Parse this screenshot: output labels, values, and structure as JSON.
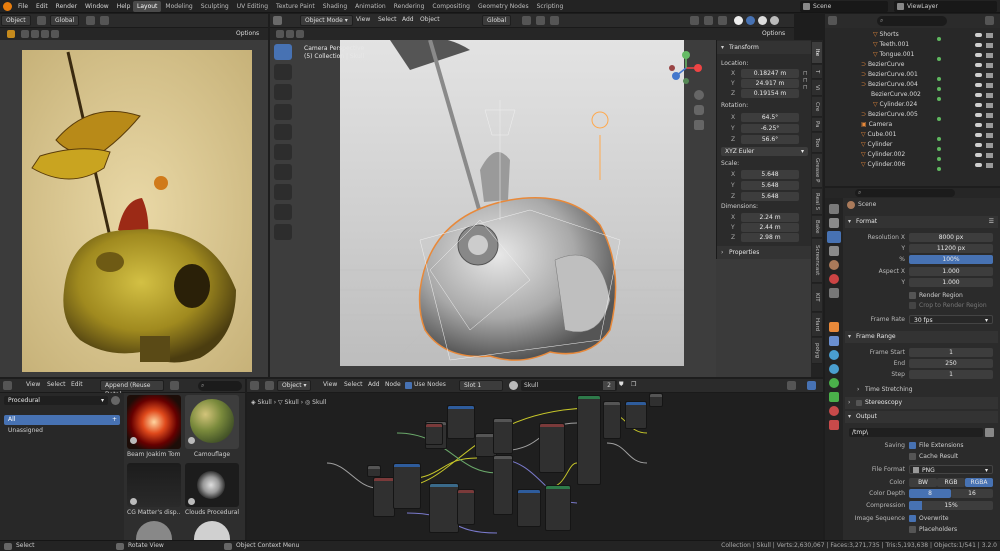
{
  "topbar": {
    "menus": [
      "File",
      "Edit",
      "Render",
      "Window",
      "Help"
    ],
    "workspaces": [
      "Layout",
      "Modeling",
      "Sculpting",
      "UV Editing",
      "Texture Paint",
      "Shading",
      "Animation",
      "Rendering",
      "Compositing",
      "Geometry Nodes",
      "Scripting"
    ],
    "active_workspace": "Layout",
    "scene": "Scene",
    "view_layer": "ViewLayer"
  },
  "image_editor": {
    "mode": "Object",
    "orientation": "Global",
    "options": "Options"
  },
  "viewport": {
    "mode": "Object Mode",
    "menus": [
      "View",
      "Select",
      "Add",
      "Object"
    ],
    "orientation": "Global",
    "options": "Options",
    "camera_label": "Camera Perspective",
    "collection_label": "(5) Collection | Skull"
  },
  "n_panel": {
    "transform_title": "Transform",
    "location_label": "Location:",
    "location": [
      [
        "X",
        "0.18247 m"
      ],
      [
        "Y",
        "24.917 m"
      ],
      [
        "Z",
        "0.19154 m"
      ]
    ],
    "rotation_label": "Rotation:",
    "rotation": [
      [
        "X",
        "64.5°"
      ],
      [
        "Y",
        "-6.25°"
      ],
      [
        "Z",
        "56.6°"
      ]
    ],
    "euler": "XYZ Euler",
    "scale_label": "Scale:",
    "scale": [
      [
        "X",
        "5.648"
      ],
      [
        "Y",
        "5.648"
      ],
      [
        "Z",
        "5.648"
      ]
    ],
    "dimensions_label": "Dimensions:",
    "dimensions": [
      [
        "X",
        "2.24 m"
      ],
      [
        "Y",
        "2.44 m"
      ],
      [
        "Z",
        "2.98 m"
      ]
    ],
    "properties": "Properties",
    "tabs": [
      "Ite",
      "T",
      "Vi",
      "Cre",
      "Pa",
      "Too",
      "Grease P",
      "Real S",
      "Bake",
      "Screencast",
      "KIT",
      "Hard",
      "polyg"
    ]
  },
  "outliner": {
    "items": [
      "Shorts",
      "Teeth.001",
      "Tongue.001",
      "BezierCurve",
      "BezierCurve.001",
      "BezierCurve.004",
      "BezierCurve.002",
      "Cylinder.024",
      "BezierCurve.005",
      "Camera",
      "Cube.001",
      "Cylinder",
      "Cylinder.002",
      "Cylinder.006"
    ]
  },
  "properties": {
    "scene_name": "Scene",
    "format_title": "Format",
    "resolution_x_label": "Resolution X",
    "resolution_x": "8000 px",
    "resolution_y_label": "Y",
    "resolution_y": "11200 px",
    "percent_label": "%",
    "percent": "100%",
    "aspect_x_label": "Aspect X",
    "aspect_x": "1.000",
    "aspect_y_label": "Y",
    "aspect_y": "1.000",
    "render_region": "Render Region",
    "crop_region": "Crop to Render Region",
    "frame_rate_label": "Frame Rate",
    "frame_rate": "30 fps",
    "frame_range_title": "Frame Range",
    "frame_start_label": "Frame Start",
    "frame_start": "1",
    "end_label": "End",
    "end": "250",
    "step_label": "Step",
    "step": "1",
    "time_stretching": "Time Stretching",
    "stereoscopy": "Stereoscopy",
    "output_title": "Output",
    "output_path": "/tmp\\",
    "saving_label": "Saving",
    "file_extensions": "File Extensions",
    "cache_result": "Cache Result",
    "file_format_label": "File Format",
    "file_format": "PNG",
    "color_label": "Color",
    "color_options": [
      "BW",
      "RGB",
      "RGBA"
    ],
    "color_selected": "RGBA",
    "color_depth_label": "Color Depth",
    "color_depth_options": [
      "8",
      "16"
    ],
    "color_depth_selected": "8",
    "compression_label": "Compression",
    "compression": "15%",
    "image_sequence_label": "Image Sequence",
    "overwrite": "Overwrite",
    "placeholders": "Placeholders"
  },
  "asset_browser": {
    "menus": [
      "View",
      "Select",
      "Edit"
    ],
    "import_mode": "Append (Reuse Data)",
    "library": "Procedural",
    "catalogs": [
      "All",
      "Unassigned"
    ],
    "assets": [
      "Beam Joakim Tom...",
      "Camouflage",
      "CG Matter's disp...",
      "Clouds Procedural ..."
    ]
  },
  "node_editor": {
    "mode": "Object",
    "menus": [
      "View",
      "Select",
      "Add",
      "Node"
    ],
    "use_nodes": "Use Nodes",
    "slot": "Slot 1",
    "material": "Skull",
    "users": "2",
    "breadcrumb": [
      "Skull",
      "Skull",
      "Skull"
    ]
  },
  "statusbar": {
    "select": "Select",
    "rotate": "Rotate View",
    "context": "Object Context Menu",
    "stats": "Collection | Skull | Verts:2,630,067 | Faces:3,271,735 | Tris:5,193,638 | Objects:1/541 | 3.2.0"
  },
  "colors": {
    "accent": "#4772b3",
    "selection": "#e8893a",
    "bg": "#1d1d1d"
  }
}
